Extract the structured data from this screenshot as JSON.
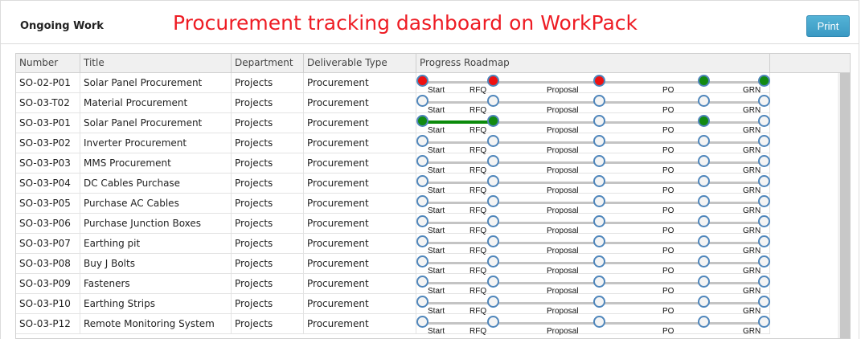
{
  "header": {
    "panel_title": "Ongoing Work",
    "annotation": "Procurement tracking dashboard on WorkPack",
    "print_label": "Print"
  },
  "table": {
    "columns": [
      "Number",
      "Title",
      "Department",
      "Deliverable Type",
      "Progress Roadmap"
    ],
    "stage_labels": [
      "Start",
      "RFQ",
      "Proposal",
      "PO",
      "GRN"
    ],
    "colors": {
      "pending": "#f4f4f4",
      "red": "#ee1111",
      "green": "#128a12",
      "complete_line": "#0b8a0b",
      "ring": "#4f86bb"
    },
    "rows": [
      {
        "number": "SO-02-P01",
        "title": "Solar Panel Procurement",
        "department": "Projects",
        "type": "Procurement",
        "stages": [
          "red",
          "red",
          "red",
          "green",
          "green"
        ],
        "done_segments": 0
      },
      {
        "number": "SO-03-T02",
        "title": "Material Procurement",
        "department": "Projects",
        "type": "Procurement",
        "stages": [
          "pending",
          "pending",
          "pending",
          "pending",
          "pending"
        ],
        "done_segments": 0
      },
      {
        "number": "SO-03-P01",
        "title": "Solar Panel Procurement",
        "department": "Projects",
        "type": "Procurement",
        "stages": [
          "green",
          "green",
          "pending",
          "green",
          "pending"
        ],
        "done_segments": 1
      },
      {
        "number": "SO-03-P02",
        "title": "Inverter Procurement",
        "department": "Projects",
        "type": "Procurement",
        "stages": [
          "pending",
          "pending",
          "pending",
          "pending",
          "pending"
        ],
        "done_segments": 0
      },
      {
        "number": "SO-03-P03",
        "title": "MMS Procurement",
        "department": "Projects",
        "type": "Procurement",
        "stages": [
          "pending",
          "pending",
          "pending",
          "pending",
          "pending"
        ],
        "done_segments": 0
      },
      {
        "number": "SO-03-P04",
        "title": "DC Cables Purchase",
        "department": "Projects",
        "type": "Procurement",
        "stages": [
          "pending",
          "pending",
          "pending",
          "pending",
          "pending"
        ],
        "done_segments": 0
      },
      {
        "number": "SO-03-P05",
        "title": "Purchase AC Cables",
        "department": "Projects",
        "type": "Procurement",
        "stages": [
          "pending",
          "pending",
          "pending",
          "pending",
          "pending"
        ],
        "done_segments": 0
      },
      {
        "number": "SO-03-P06",
        "title": "Purchase Junction Boxes",
        "department": "Projects",
        "type": "Procurement",
        "stages": [
          "pending",
          "pending",
          "pending",
          "pending",
          "pending"
        ],
        "done_segments": 0
      },
      {
        "number": "SO-03-P07",
        "title": "Earthing pit",
        "department": "Projects",
        "type": "Procurement",
        "stages": [
          "pending",
          "pending",
          "pending",
          "pending",
          "pending"
        ],
        "done_segments": 0
      },
      {
        "number": "SO-03-P08",
        "title": "Buy J Bolts",
        "department": "Projects",
        "type": "Procurement",
        "stages": [
          "pending",
          "pending",
          "pending",
          "pending",
          "pending"
        ],
        "done_segments": 0
      },
      {
        "number": "SO-03-P09",
        "title": "Fasteners",
        "department": "Projects",
        "type": "Procurement",
        "stages": [
          "pending",
          "pending",
          "pending",
          "pending",
          "pending"
        ],
        "done_segments": 0
      },
      {
        "number": "SO-03-P10",
        "title": "Earthing Strips",
        "department": "Projects",
        "type": "Procurement",
        "stages": [
          "pending",
          "pending",
          "pending",
          "pending",
          "pending"
        ],
        "done_segments": 0
      },
      {
        "number": "SO-03-P12",
        "title": "Remote Monitoring System",
        "department": "Projects",
        "type": "Procurement",
        "stages": [
          "pending",
          "pending",
          "pending",
          "pending",
          "pending"
        ],
        "done_segments": 0
      }
    ]
  }
}
